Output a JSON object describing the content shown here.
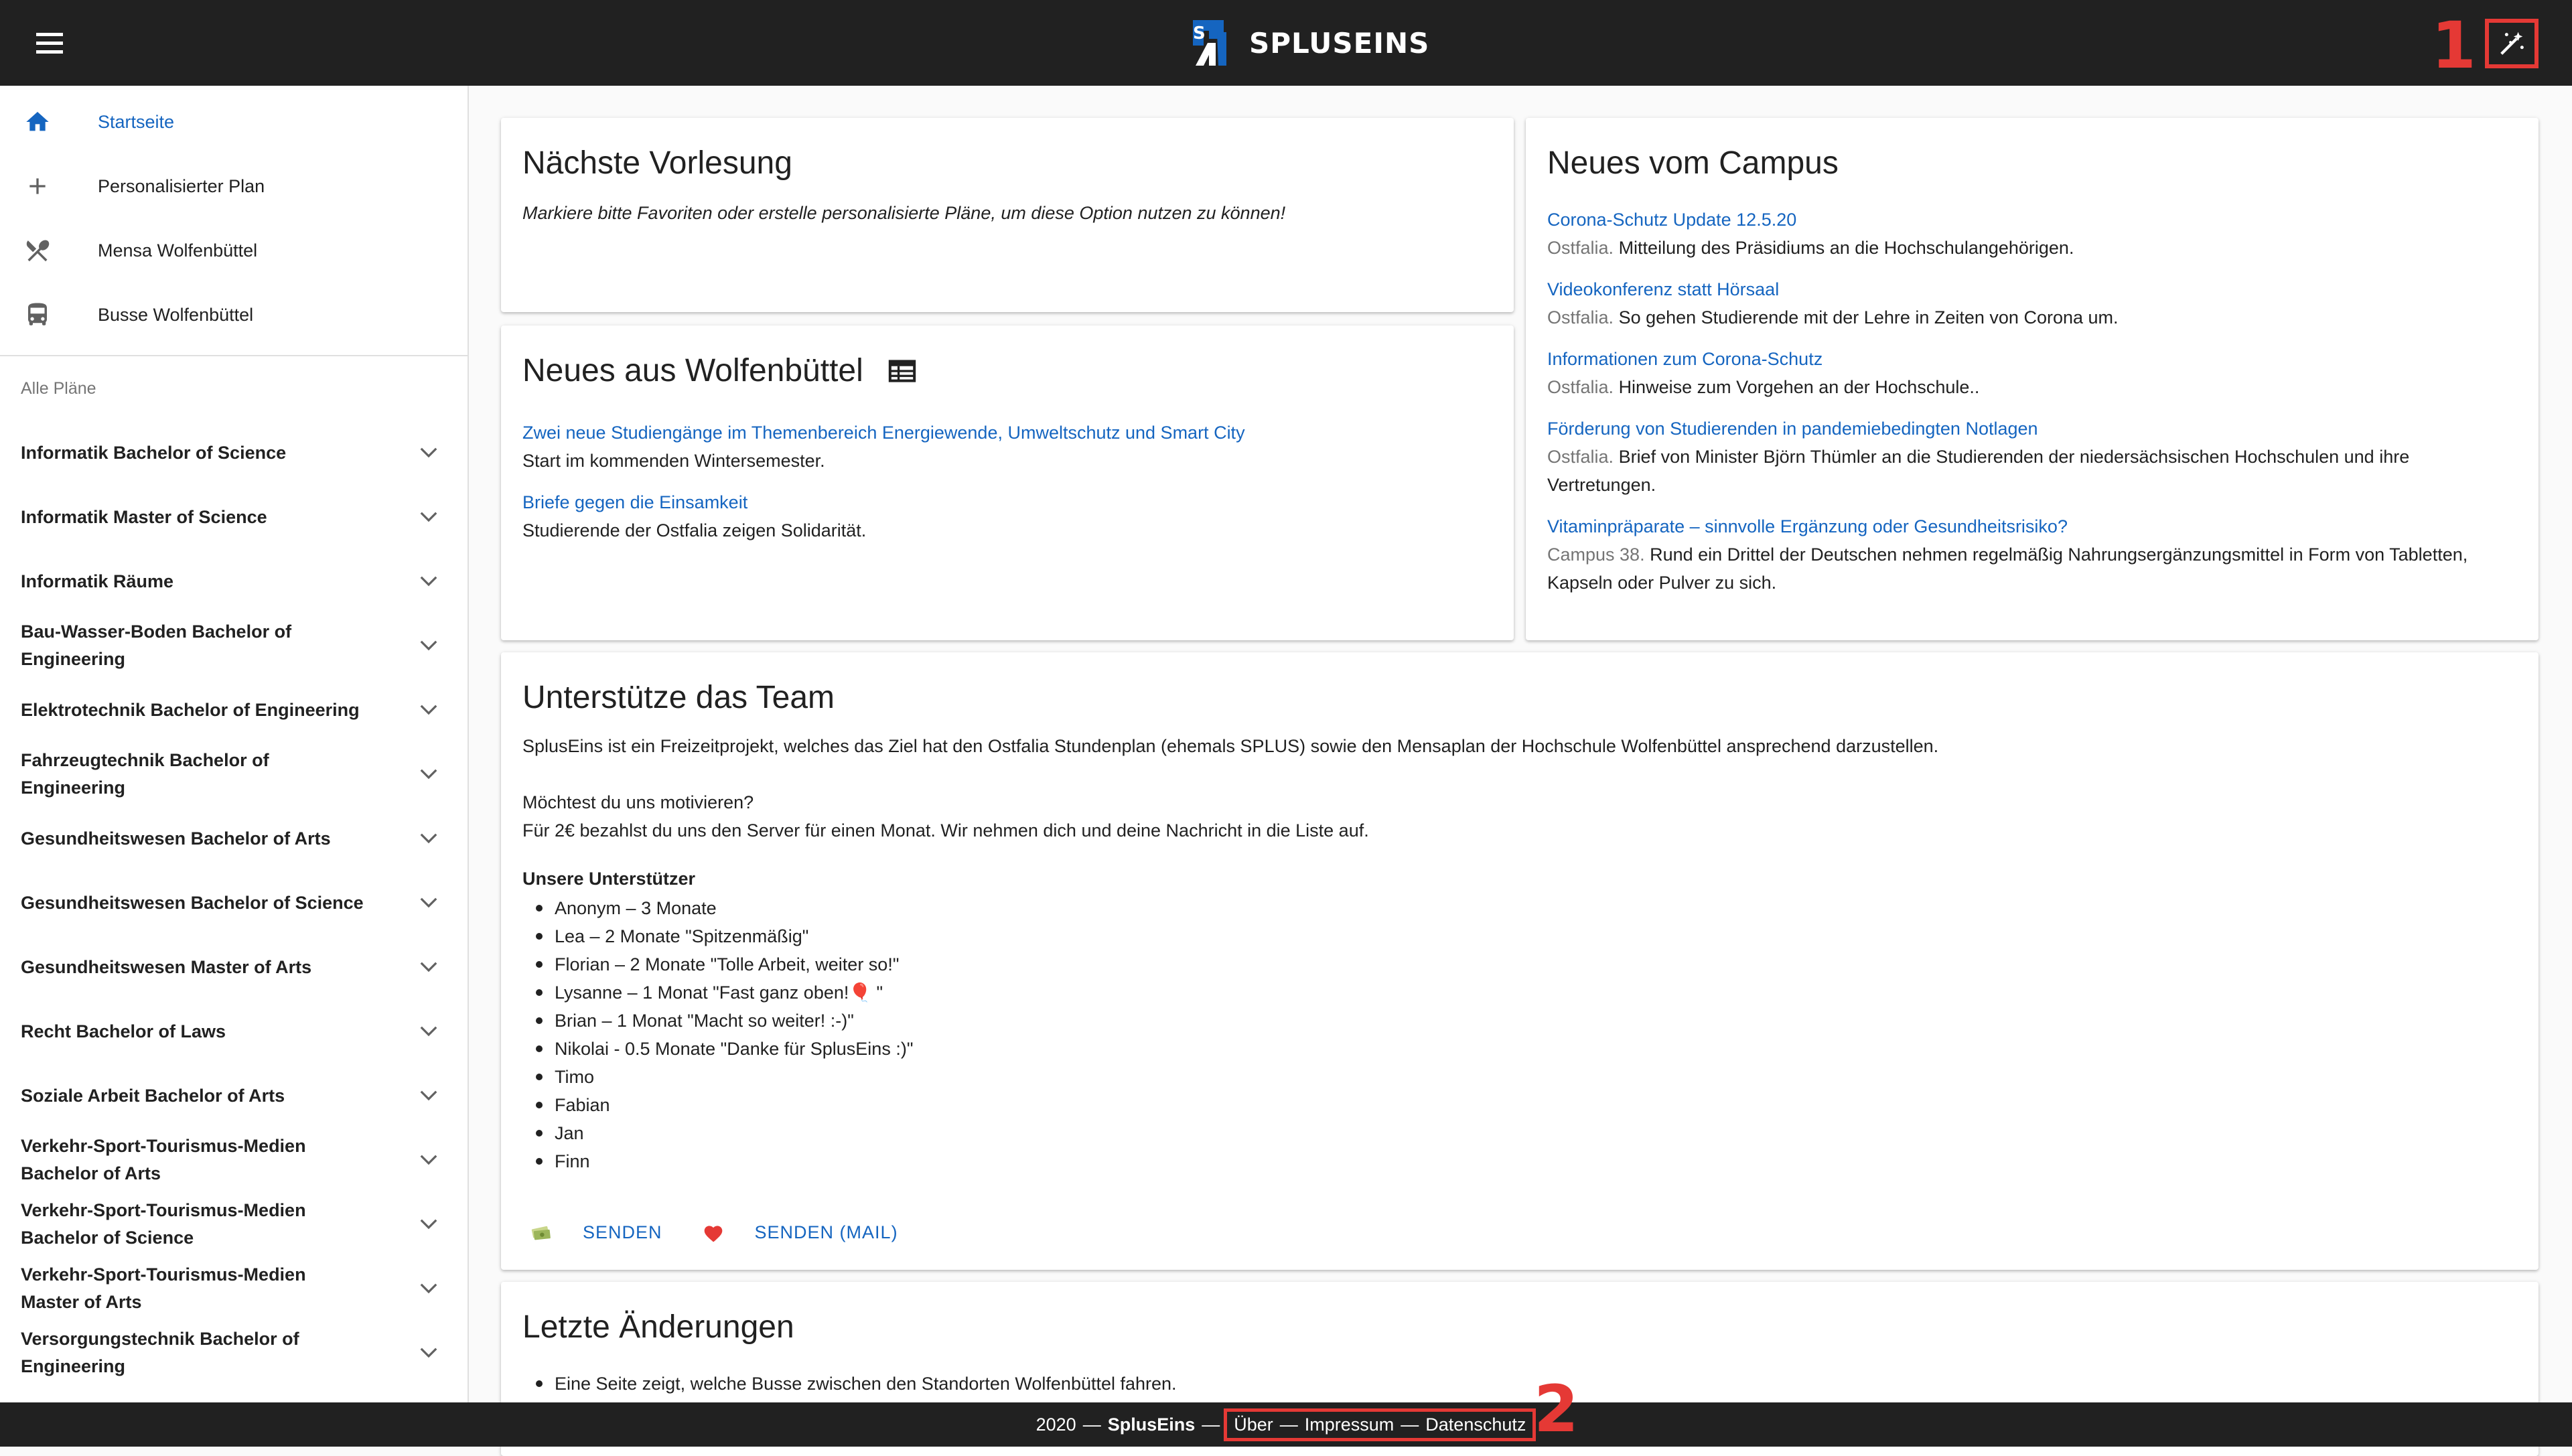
{
  "app": {
    "name": "SPLUSEINS"
  },
  "annotations": {
    "one": "1",
    "two": "2"
  },
  "colors": {
    "accent": "#1565c0",
    "topbar": "#212121",
    "highlight": "#e53935"
  },
  "sidebar": {
    "nav": [
      {
        "label": "Startseite",
        "icon": "home-icon"
      },
      {
        "label": "Personalisierter Plan",
        "icon": "plus-icon"
      },
      {
        "label": "Mensa Wolfenbüttel",
        "icon": "restaurant-icon"
      },
      {
        "label": "Busse Wolfenbüttel",
        "icon": "bus-icon"
      }
    ],
    "section_label": "Alle Pläne",
    "plans": [
      "Informatik Bachelor of Science",
      "Informatik Master of Science",
      "Informatik Räume",
      "Bau-Wasser-Boden Bachelor of Engineering",
      "Elektrotechnik Bachelor of Engineering",
      "Fahrzeugtechnik Bachelor of Engineering",
      "Gesundheitswesen Bachelor of Arts",
      "Gesundheitswesen Bachelor of Science",
      "Gesundheitswesen Master of Arts",
      "Recht Bachelor of Laws",
      "Soziale Arbeit Bachelor of Arts",
      "Verkehr-Sport-Tourismus-Medien Bachelor of Arts",
      "Verkehr-Sport-Tourismus-Medien Bachelor of Science",
      "Verkehr-Sport-Tourismus-Medien Master of Arts",
      "Versorgungstechnik Bachelor of Engineering"
    ]
  },
  "next_lecture": {
    "title": "Nächste Vorlesung",
    "text": "Markiere bitte Favoriten oder erstelle personalisierte Pläne, um diese Option nutzen zu können!"
  },
  "wolfenbuettel": {
    "title": "Neues aus Wolfenbüttel",
    "items": [
      {
        "title": "Zwei neue Studiengänge im Themenbereich Energiewende, Umweltschutz und Smart City",
        "text": "Start im kommenden Wintersemester."
      },
      {
        "title": "Briefe gegen die Einsamkeit",
        "text": "Studierende der Ostfalia zeigen Solidarität."
      }
    ]
  },
  "campus": {
    "title": "Neues vom Campus",
    "items": [
      {
        "title": "Corona-Schutz Update 12.5.20",
        "source": "Ostfalia.",
        "text": "Mitteilung des Präsidiums an die Hochschulangehörigen."
      },
      {
        "title": "Videokonferenz statt Hörsaal",
        "source": "Ostfalia.",
        "text": "So gehen Studierende mit der Lehre in Zeiten von Corona um."
      },
      {
        "title": "Informationen zum Corona-Schutz",
        "source": "Ostfalia.",
        "text": "Hinweise zum Vorgehen an der Hochschule.."
      },
      {
        "title": "Förderung von Studierenden in pandemiebedingten Notlagen",
        "source": "Ostfalia.",
        "text": "Brief von Minister Björn Thümler an die Studierenden der niedersächsischen Hochschulen und ihre Vertretungen."
      },
      {
        "title": "Vitaminpräparate – sinnvolle Ergänzung oder Gesundheitsrisiko?",
        "source": "Campus 38.",
        "text": "Rund ein Drittel der Deutschen nehmen regelmäßig Nahrungsergänzungsmittel in Form von Tabletten, Kapseln oder Pulver zu sich."
      }
    ]
  },
  "support": {
    "title": "Unterstütze das Team",
    "intro": "SplusEins ist ein Freizeitprojekt, welches das Ziel hat den Ostfalia Stundenplan (ehemals SPLUS) sowie den Mensaplan der Hochschule Wolfenbüttel ansprechend darzustellen.",
    "question": "Möchtest du uns motivieren?",
    "offer": "Für 2€ bezahlst du uns den Server für einen Monat. Wir nehmen dich und deine Nachricht in die Liste auf.",
    "supporters_heading": "Unsere Unterstützer",
    "supporters": [
      "Anonym – 3 Monate",
      "Lea – 2 Monate \"Spitzenmäßig\"",
      "Florian – 2 Monate \"Tolle Arbeit, weiter so!\"",
      "Lysanne – 1 Monat \"Fast ganz oben!🎈 \"",
      "Brian – 1 Monat \"Macht so weiter! :-)\"",
      "Nikolai - 0.5 Monate \"Danke für SplusEins :)\"",
      "Timo",
      "Fabian",
      "Jan",
      "Finn"
    ],
    "send_label": "SENDEN",
    "send_mail_label": "SENDEN (MAIL)"
  },
  "changes": {
    "title": "Letzte Änderungen",
    "items": [
      "Eine Seite zeigt, welche Busse zwischen den Standorten Wolfenbüttel fahren."
    ]
  },
  "footer": {
    "year": "2020",
    "dash1": "—",
    "brand": "SplusEins",
    "dash2": "—",
    "about": "Über",
    "sep1": "—",
    "imprint": "Impressum",
    "sep2": "—",
    "privacy": "Datenschutz"
  }
}
